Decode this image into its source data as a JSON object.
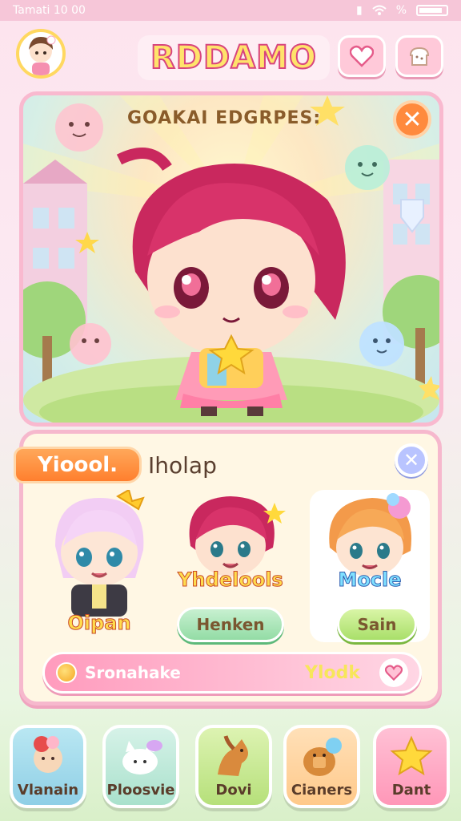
{
  "status_bar": {
    "carrier_time": "Tamati 10 00",
    "signal_text": "%"
  },
  "header": {
    "title": "RDDAMO"
  },
  "scene": {
    "title": "GOAKAI EDGRPES:",
    "close_label": "✕"
  },
  "panel": {
    "tag_label": "Yioool.",
    "heading": "Iholap",
    "close_label": "✕",
    "cards": [
      {
        "label": "Oipan",
        "button": ""
      },
      {
        "label": "Yhdelools",
        "button": "Henken"
      },
      {
        "label": "Mocle",
        "button": "Sain"
      }
    ],
    "progress": {
      "left_text": "Sronahake",
      "right_text": "Ylodk"
    }
  },
  "nav": {
    "items": [
      {
        "label": "Vlanain"
      },
      {
        "label": "Ploosvie"
      },
      {
        "label": "Dovi"
      },
      {
        "label": "Cianers"
      },
      {
        "label": "Dant"
      }
    ]
  },
  "colors": {
    "accent_pink": "#f6b8cd",
    "orange": "#ff8a3d",
    "green": "#93dca5"
  }
}
